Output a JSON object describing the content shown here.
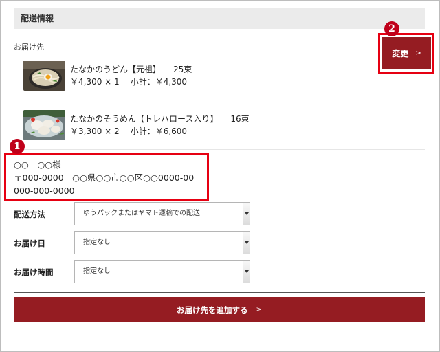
{
  "section": {
    "title": "配送情報"
  },
  "destination": {
    "label": "お届け先",
    "change_button": {
      "label": "変更",
      "chevron": ">"
    }
  },
  "items": [
    {
      "name": "たなかのうどん【元祖】",
      "count": "25束",
      "price": "￥4,300 × 1",
      "subtotal": "小計：￥4,300",
      "icon": "udon-photo"
    },
    {
      "name": "たなかのそうめん【トレハロース入り】",
      "count": "16束",
      "price": "￥3,300 × 2",
      "subtotal": "小計：￥6,600",
      "icon": "somen-photo"
    }
  ],
  "address": {
    "name": "○○　○○様",
    "postal_line": "〒000-0000　○○県○○市○○区○○0000-00",
    "phone": "000-000-0000"
  },
  "fields": {
    "shipping_method": {
      "label": "配送方法",
      "value": "ゆうパックまたはヤマト運輸での配送"
    },
    "delivery_date": {
      "label": "お届け日",
      "value": "指定なし"
    },
    "delivery_time": {
      "label": "お届け時間",
      "value": "指定なし"
    }
  },
  "add_destination_button": {
    "label": "お届け先を追加する",
    "chevron": ">"
  },
  "annotations": [
    {
      "number": "1"
    },
    {
      "number": "2"
    }
  ],
  "colors": {
    "accent": "#951c22",
    "highlight": "#e60012",
    "header_bg": "#ebebeb"
  }
}
